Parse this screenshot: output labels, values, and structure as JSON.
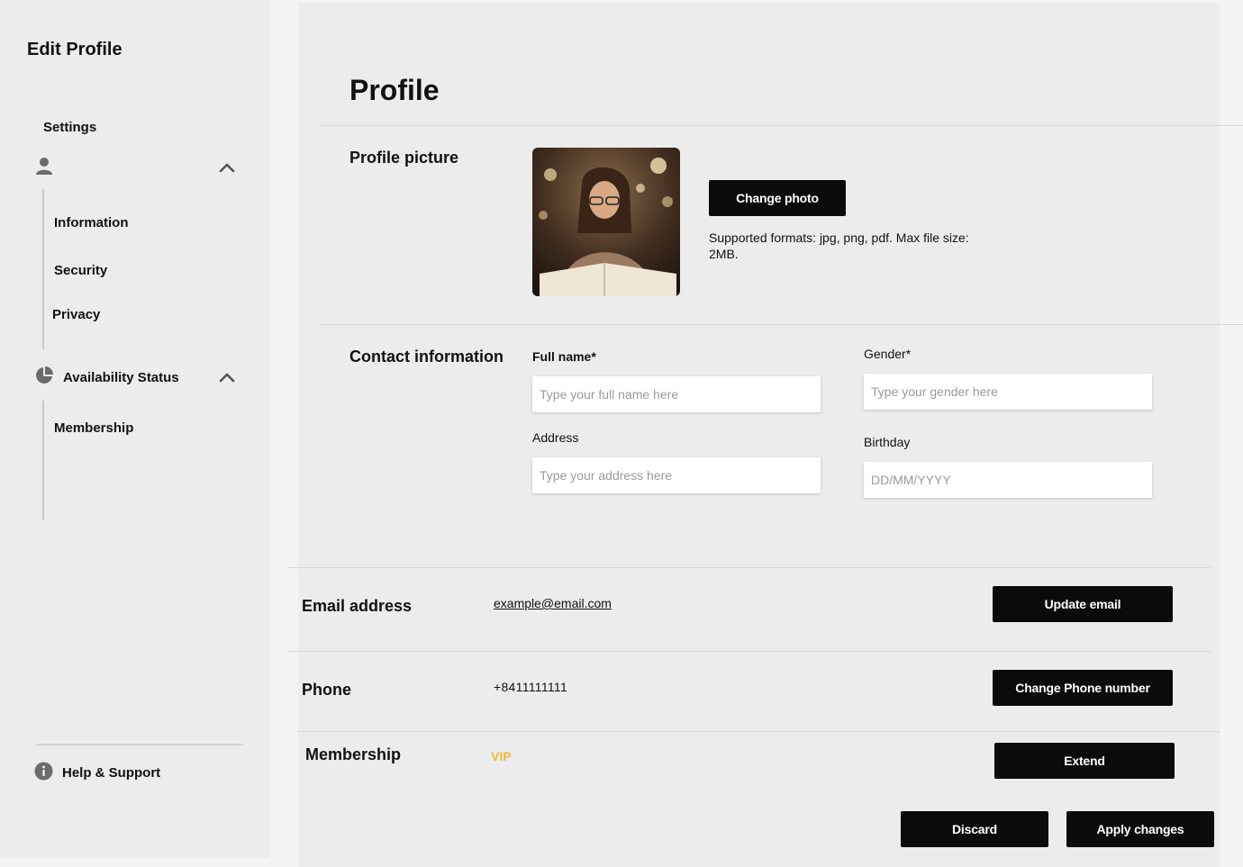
{
  "sidebar": {
    "title": "Edit Profile",
    "settings_label": "Settings",
    "profile_group": {
      "items": [
        "Information",
        "Security",
        "Privacy"
      ]
    },
    "availability_group": {
      "label": "Availability Status",
      "items": [
        "Membership"
      ]
    },
    "help_label": "Help & Support"
  },
  "main": {
    "title": "Profile",
    "profile_picture": {
      "label": "Profile picture",
      "change_button": "Change photo",
      "hint": "Supported formats: jpg, png, pdf. Max file size: 2MB."
    },
    "contact": {
      "label": "Contact information",
      "full_name": {
        "label": "Full name*",
        "placeholder": "Type your full name here"
      },
      "gender": {
        "label": "Gender*",
        "placeholder": "Type your gender here"
      },
      "address": {
        "label": "Address",
        "placeholder": "Type your address here"
      },
      "birthday": {
        "label": "Birthday",
        "placeholder": "DD/MM/YYYY"
      }
    },
    "email": {
      "label": "Email address",
      "value": "example@email.com",
      "button": "Update email"
    },
    "phone": {
      "label": "Phone",
      "value": "+8411111111",
      "button": "Change Phone number"
    },
    "membership": {
      "label": "Membership",
      "value": "VIP",
      "button": "Extend"
    },
    "actions": {
      "discard": "Discard",
      "apply": "Apply changes"
    }
  },
  "colors": {
    "vip": "#f0b93a",
    "button_bg": "#0b0b0c",
    "panel_bg": "#ececec"
  },
  "icons": [
    "user-icon",
    "chevron-up-icon",
    "pie-chart-icon",
    "info-icon"
  ]
}
